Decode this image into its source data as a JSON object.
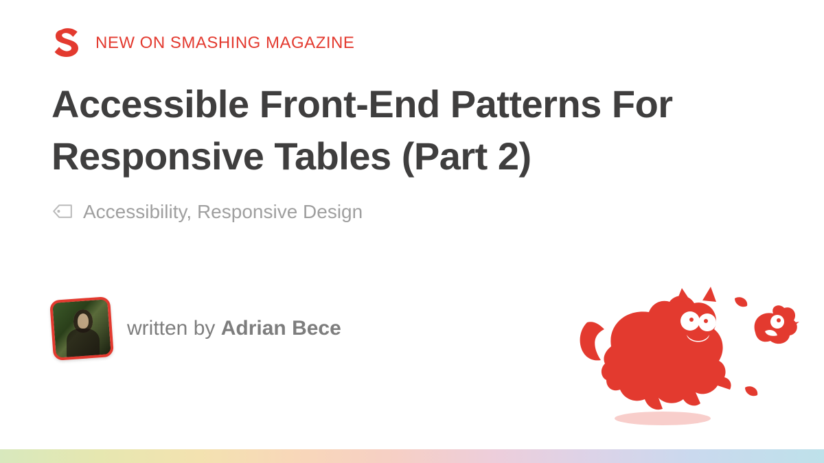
{
  "kicker": "NEW ON SMASHING MAGAZINE",
  "title": "Accessible Front-End Patterns For Responsive Tables (Part 2)",
  "tags": "Accessibility, Responsive Design",
  "byline_prefix": "written by ",
  "author_name": "Adrian Bece",
  "colors": {
    "brand": "#e33a2f",
    "heading": "#3f3e3e",
    "muted": "#9f9f9f"
  }
}
